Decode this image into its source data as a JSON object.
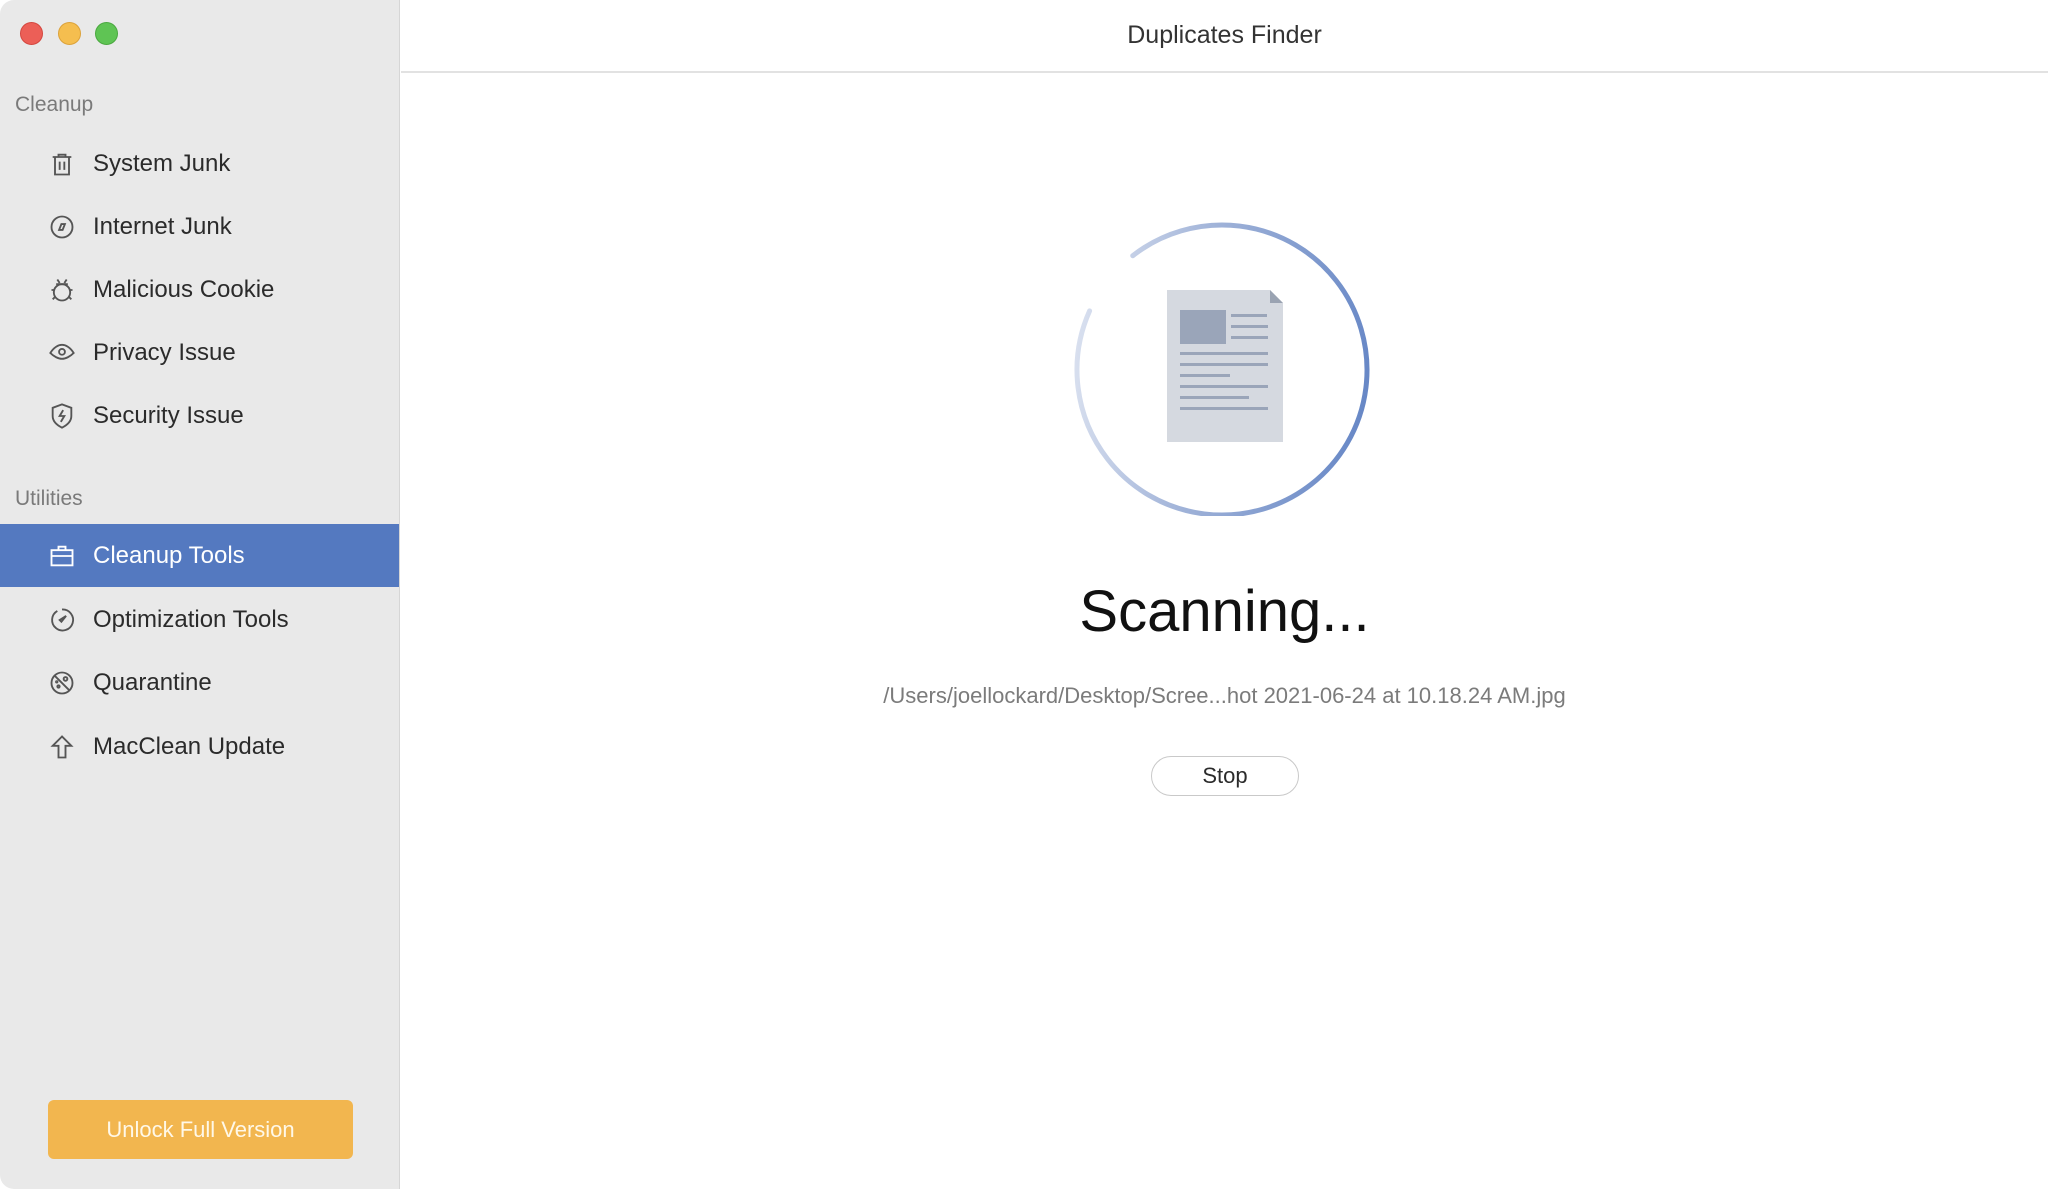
{
  "window": {
    "title": "Duplicates Finder",
    "traffic_lights": [
      "close",
      "minimize",
      "zoom"
    ]
  },
  "sidebar": {
    "sections": [
      {
        "label": "Cleanup",
        "items": [
          {
            "label": "System Junk",
            "icon": "trash-icon"
          },
          {
            "label": "Internet Junk",
            "icon": "compass-icon"
          },
          {
            "label": "Malicious Cookie",
            "icon": "bug-icon"
          },
          {
            "label": "Privacy Issue",
            "icon": "eye-icon"
          },
          {
            "label": "Security Issue",
            "icon": "shield-bolt-icon"
          }
        ]
      },
      {
        "label": "Utilities",
        "items": [
          {
            "label": "Cleanup Tools",
            "icon": "toolbox-icon",
            "selected": true
          },
          {
            "label": "Optimization Tools",
            "icon": "gauge-icon"
          },
          {
            "label": "Quarantine",
            "icon": "quarantine-icon"
          },
          {
            "label": "MacClean Update",
            "icon": "arrow-up-icon"
          }
        ]
      }
    ],
    "unlock_label": "Unlock Full Version"
  },
  "main": {
    "status": "Scanning...",
    "current_path": "/Users/joellockard/Desktop/Scree...hot 2021-06-24 at 10.18.24 AM.jpg",
    "stop_label": "Stop",
    "icon": "document-icon"
  },
  "colors": {
    "accent": "#5479c0",
    "unlock": "#f2b64f",
    "close": "#ec5f57",
    "minimize": "#f5be4f",
    "zoom": "#5fc454"
  }
}
